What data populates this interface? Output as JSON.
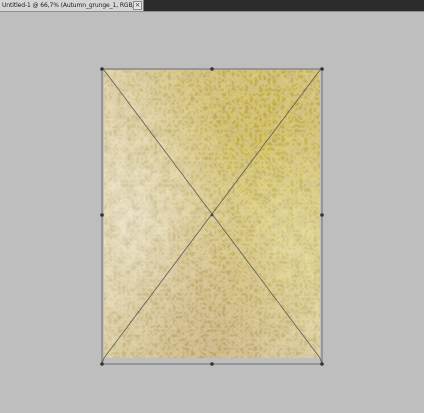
{
  "document_tab": {
    "title": "Untitled-1 @ 66,7% (Autumn_grunge_1, RGB/8)",
    "close_glyph": "×"
  },
  "canvas": {
    "background_color": "#bebebe",
    "layer_name": "Autumn_grunge_1",
    "transform_active": true,
    "texture_colors": [
      "#d9c48a",
      "#c9b24e",
      "#b7a03a",
      "#e6dcc0",
      "#a0783a"
    ]
  },
  "icons": {
    "close": "close-icon",
    "handles": "transform-handle-icon"
  }
}
